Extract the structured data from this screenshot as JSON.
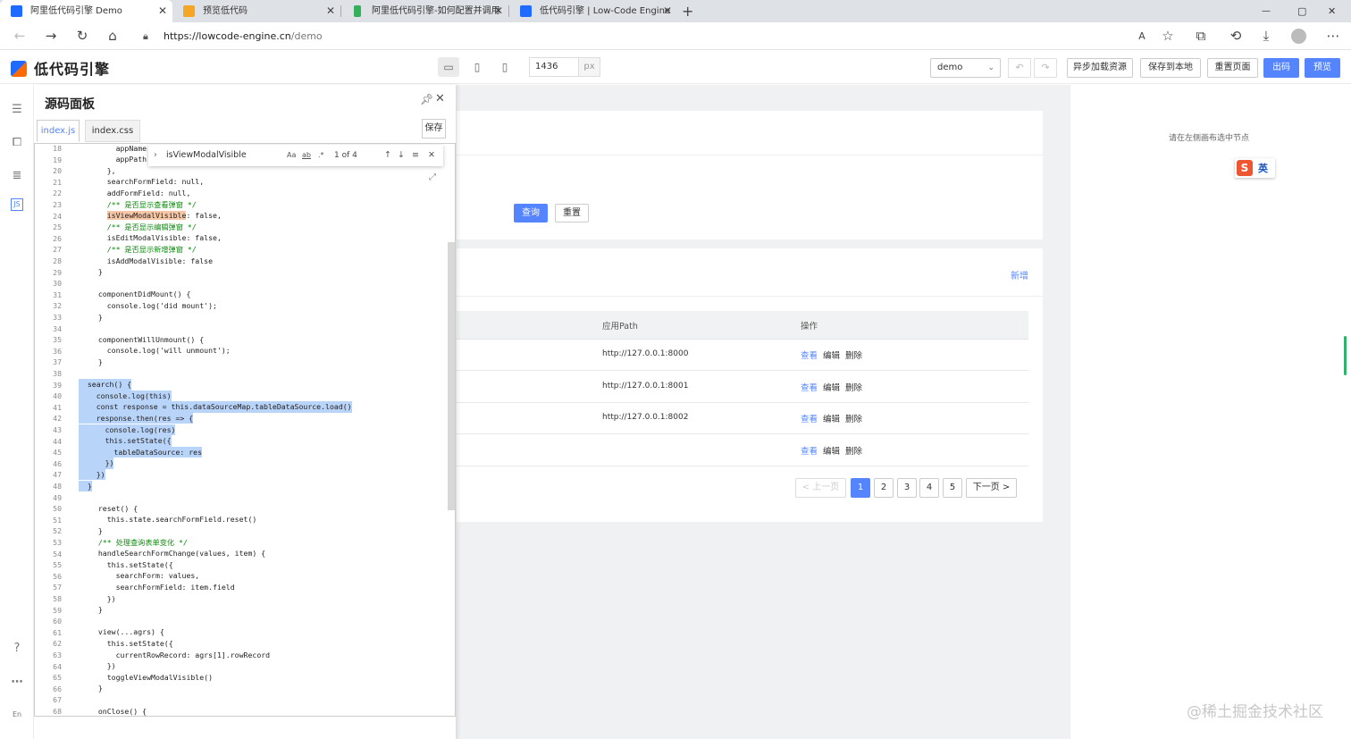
{
  "browser": {
    "tabs": [
      {
        "title": "阿里低代码引擎 Demo",
        "active": true
      },
      {
        "title": "预览低代码",
        "active": false
      },
      {
        "title": "阿里低代码引擎-如何配置并调用",
        "active": false
      },
      {
        "title": "低代码引擎 | Low-Code Engine",
        "active": false
      }
    ],
    "new_tab": "+",
    "url_host": "https://lowcode-engine.cn",
    "url_path": "/demo",
    "controls": {
      "minimize": "—",
      "maximize": "▢",
      "close": "✕"
    }
  },
  "topbar": {
    "logo_text": "低代码引擎",
    "width_value": "1436",
    "width_unit": "px",
    "scenario_select": "demo",
    "buttons": [
      "异步加载资源",
      "保存到本地",
      "重置页面",
      "出码",
      "预览"
    ]
  },
  "source_panel": {
    "title": "源码面板",
    "tabs": [
      "index.js",
      "index.css"
    ],
    "save_label": "保存",
    "find": {
      "query": "isViewModalVisible",
      "count": "1 of 4",
      "opt_case": "Aa",
      "opt_word": "ab",
      "opt_regex": ".*"
    },
    "lines": [
      {
        "n": "18",
        "code": "      appName:"
      },
      {
        "n": "19",
        "code": "      appPath:"
      },
      {
        "n": "20",
        "code": "    },"
      },
      {
        "n": "21",
        "code": "    searchFormField: null,"
      },
      {
        "n": "22",
        "code": "    addFormField: null,"
      },
      {
        "n": "23",
        "code": "    /** 是否显示查看弹窗 */"
      },
      {
        "n": "24",
        "code": "    isViewModalVisible: false,"
      },
      {
        "n": "25",
        "code": "    /** 是否显示编辑弹窗 */"
      },
      {
        "n": "26",
        "code": "    isEditModalVisible: false,"
      },
      {
        "n": "27",
        "code": "    /** 是否显示新增弹窗 */"
      },
      {
        "n": "28",
        "code": "    isAddModalVisible: false"
      },
      {
        "n": "29",
        "code": "  }"
      },
      {
        "n": "30",
        "code": ""
      },
      {
        "n": "31",
        "code": "  componentDidMount() {"
      },
      {
        "n": "32",
        "code": "    console.log('did mount');"
      },
      {
        "n": "33",
        "code": "  }"
      },
      {
        "n": "34",
        "code": ""
      },
      {
        "n": "35",
        "code": "  componentWillUnmount() {"
      },
      {
        "n": "36",
        "code": "    console.log('will unmount');"
      },
      {
        "n": "37",
        "code": "  }"
      },
      {
        "n": "38",
        "code": ""
      },
      {
        "n": "39",
        "code": "  search() {"
      },
      {
        "n": "40",
        "code": "    console.log(this)"
      },
      {
        "n": "41",
        "code": "    const response = this.dataSourceMap.tableDataSource.load()"
      },
      {
        "n": "42",
        "code": "    response.then(res => {"
      },
      {
        "n": "43",
        "code": "      console.log(res)"
      },
      {
        "n": "44",
        "code": "      this.setState({"
      },
      {
        "n": "45",
        "code": "        tableDataSource: res"
      },
      {
        "n": "46",
        "code": "      })"
      },
      {
        "n": "47",
        "code": "    })"
      },
      {
        "n": "48",
        "code": "  }"
      },
      {
        "n": "49",
        "code": ""
      },
      {
        "n": "50",
        "code": "  reset() {"
      },
      {
        "n": "51",
        "code": "    this.state.searchFormField.reset()"
      },
      {
        "n": "52",
        "code": "  }"
      },
      {
        "n": "53",
        "code": "  /** 处理查询表单变化 */"
      },
      {
        "n": "54",
        "code": "  handleSearchFormChange(values, item) {"
      },
      {
        "n": "55",
        "code": "    this.setState({"
      },
      {
        "n": "56",
        "code": "      searchForm: values,"
      },
      {
        "n": "57",
        "code": "      searchFormField: item.field"
      },
      {
        "n": "58",
        "code": "    })"
      },
      {
        "n": "59",
        "code": "  }"
      },
      {
        "n": "60",
        "code": ""
      },
      {
        "n": "61",
        "code": "  view(...agrs) {"
      },
      {
        "n": "62",
        "code": "    this.setState({"
      },
      {
        "n": "63",
        "code": "      currentRowRecord: agrs[1].rowRecord"
      },
      {
        "n": "64",
        "code": "    })"
      },
      {
        "n": "65",
        "code": "    toggleViewModalVisible()"
      },
      {
        "n": "66",
        "code": "  }"
      },
      {
        "n": "67",
        "code": ""
      },
      {
        "n": "68",
        "code": "  onClose() {"
      }
    ]
  },
  "canvas": {
    "query_button": "查询",
    "reset_button": "重置",
    "add_link": "新增",
    "table": {
      "headers": [
        "应用Path",
        "操作"
      ],
      "rows": [
        {
          "path": "http://127.0.0.1:8000",
          "actions": [
            "查看",
            "编辑",
            "删除"
          ]
        },
        {
          "path": "http://127.0.0.1:8001",
          "actions": [
            "查看",
            "编辑",
            "删除"
          ]
        },
        {
          "path": "http://127.0.0.1:8002",
          "actions": [
            "查看",
            "编辑",
            "删除"
          ]
        },
        {
          "path": "",
          "actions": [
            "查看",
            "编辑",
            "删除"
          ]
        }
      ]
    },
    "pagination": {
      "prev": "< 上一页",
      "pages": [
        "1",
        "2",
        "3",
        "4",
        "5"
      ],
      "current": "1",
      "next": "下一页 >"
    }
  },
  "right_panel": {
    "hint": "请在左侧画布选中节点",
    "ime_label": "英"
  },
  "watermark": "@稀土掘金技术社区",
  "colors": {
    "accent": "#5584ff",
    "link": "#5584ff",
    "selection": "#b9d4f9",
    "find_highlight": "#f6c7a6"
  }
}
